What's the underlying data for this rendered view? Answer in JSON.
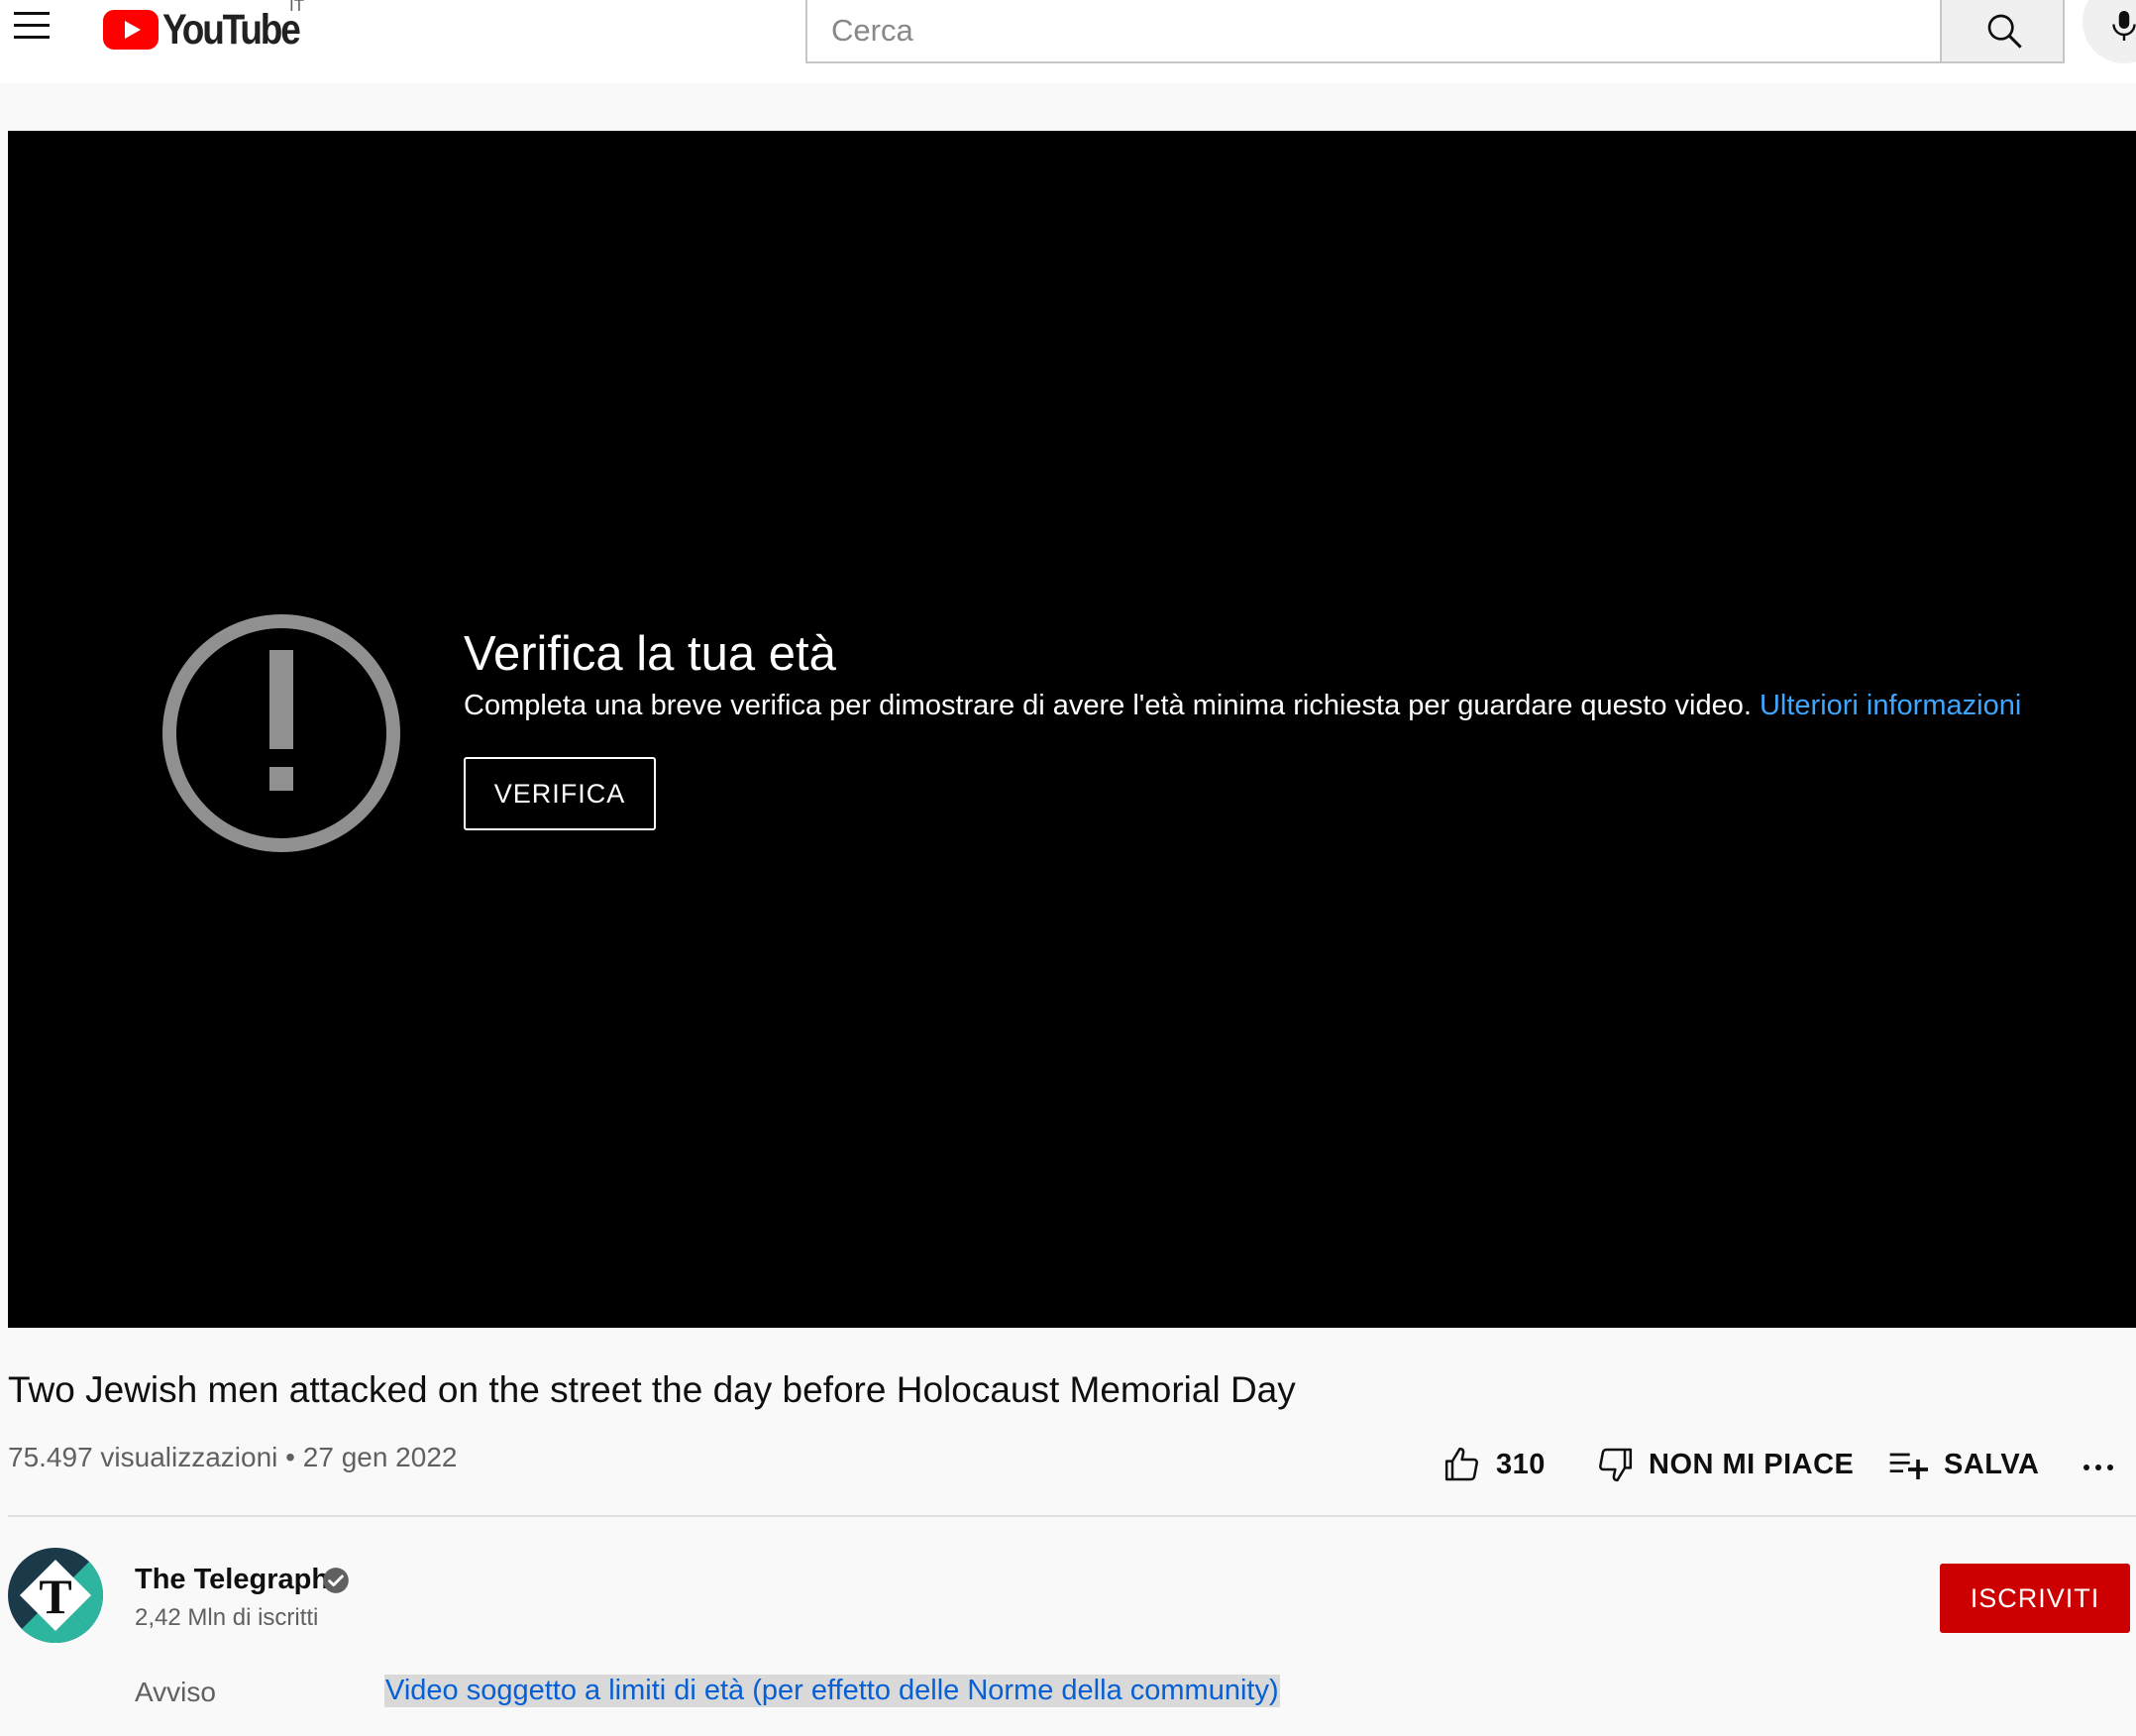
{
  "masthead": {
    "logo_text": "YouTube",
    "country_code": "IT",
    "search_placeholder": "Cerca",
    "search_value": ""
  },
  "player": {
    "title": "Verifica la tua età",
    "description": "Completa una breve verifica per dimostrare di avere l'età minima richiesta per guardare questo video.",
    "learn_more": "Ulteriori informazioni",
    "verify_button": "VERIFICA"
  },
  "video": {
    "title": "Two Jewish men attacked on the street the day before Holocaust Memorial Day",
    "views": "75.497 visualizzazioni",
    "separator": " • ",
    "date": "27 gen 2022"
  },
  "actions": {
    "like_count": "310",
    "dislike_label": "NON MI PIACE",
    "save_label": "SALVA"
  },
  "channel": {
    "name": "The Telegraph",
    "subscribers": "2,42 Mln di iscritti",
    "subscribe_label": "ISCRIVITI"
  },
  "notice": {
    "label": "Avviso",
    "link": "Video soggetto a limiti di età (per effetto delle Norme della community)"
  },
  "icons": {
    "menu": "hamburger-menu-icon",
    "search": "search-icon",
    "mic": "microphone-icon",
    "warning": "exclamation-circle-icon",
    "like": "thumbs-up-icon",
    "dislike": "thumbs-down-icon",
    "save": "playlist-add-icon",
    "more": "more-horizontal-icon",
    "verified": "verified-check-icon"
  },
  "colors": {
    "brand_red": "#ff0000",
    "subscribe_red": "#cc0000",
    "link_blue": "#065fd4",
    "player_link_blue": "#3ea6ff"
  }
}
